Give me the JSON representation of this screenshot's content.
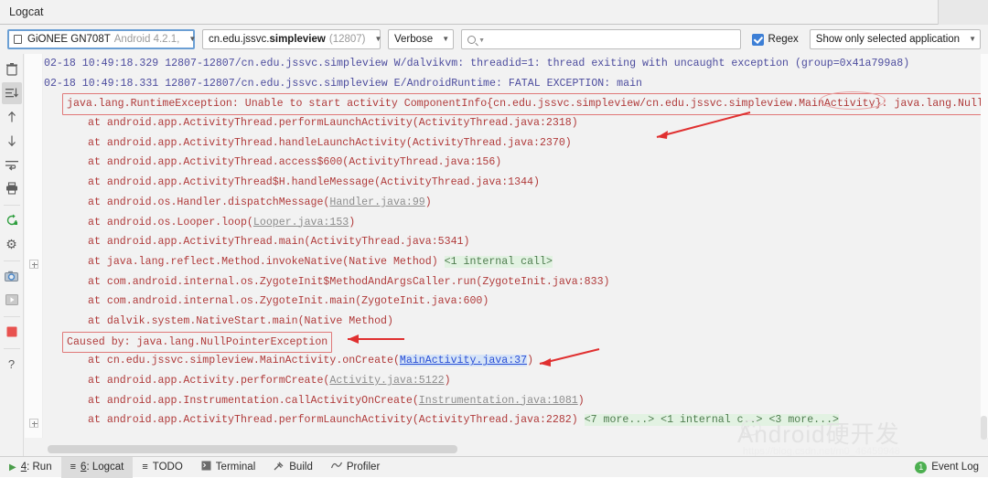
{
  "window": {
    "title": "Logcat",
    "gear_icon": "gear-icon",
    "minimize_icon": "minimize-icon"
  },
  "toolbar": {
    "device": {
      "name": "GiONEE GN708T",
      "detail": "Android 4.2.1, ",
      "caret": "▼"
    },
    "process": {
      "prefix": "cn.edu.jssvc.",
      "name": "simpleview",
      "pid": "(12807)",
      "caret": "▼"
    },
    "level": {
      "value": "Verbose",
      "caret": "▼"
    },
    "search": {
      "value": "",
      "placeholder": ""
    },
    "regex": {
      "label": "Regex",
      "checked": true
    },
    "filter": {
      "value": "Show only selected application",
      "caret": "▼"
    }
  },
  "rail": {
    "items": [
      {
        "name": "clear-logcat-icon",
        "glyph": "🗑",
        "selected": false
      },
      {
        "name": "scroll-to-end-icon",
        "glyph": "≡↓",
        "selected": true
      },
      {
        "name": "up-arrow-icon",
        "glyph": "↑",
        "selected": false
      },
      {
        "name": "down-arrow-icon",
        "glyph": "↓",
        "selected": false
      },
      {
        "name": "soft-wrap-icon",
        "glyph": "↵",
        "selected": false
      },
      {
        "name": "print-icon",
        "glyph": "⎙",
        "selected": false
      },
      {
        "name": "restart-icon",
        "glyph": "↻",
        "selected": false
      },
      {
        "name": "settings-gear-icon",
        "glyph": "⚙",
        "selected": false
      },
      {
        "name": "screenshot-camera-icon",
        "glyph": "📷",
        "selected": false
      },
      {
        "name": "screen-record-icon",
        "glyph": "▶",
        "selected": false
      },
      {
        "name": "stop-icon",
        "glyph": "■",
        "selected": false
      },
      {
        "name": "help-icon",
        "glyph": "?",
        "selected": false
      }
    ]
  },
  "log": {
    "lines": [
      {
        "id": "line-1",
        "level": "warn",
        "indent": 0,
        "text": "02-18 10:49:18.329 12807-12807/cn.edu.jssvc.simpleview W/dalvikvm: threadid=1: thread exiting with uncaught exception (group=0x41a799a8)"
      },
      {
        "id": "line-2",
        "level": "warn",
        "indent": 0,
        "text": "02-18 10:49:18.331 12807-12807/cn.edu.jssvc.simpleview E/AndroidRuntime: FATAL EXCEPTION: main"
      },
      {
        "id": "line-3",
        "level": "err",
        "indent": 1,
        "boxed": true,
        "text": "java.lang.RuntimeException: Unable to start activity ComponentInfo{cn.edu.jssvc.simpleview/cn.edu.jssvc.simpleview.MainActivity}: java.lang.NullP"
      },
      {
        "id": "line-4",
        "level": "err",
        "indent": 2,
        "text": "at android.app.ActivityThread.performLaunchActivity(ActivityThread.java:2318)"
      },
      {
        "id": "line-5",
        "level": "err",
        "indent": 2,
        "text": "at android.app.ActivityThread.handleLaunchActivity(ActivityThread.java:2370)"
      },
      {
        "id": "line-6",
        "level": "err",
        "indent": 2,
        "text": "at android.app.ActivityThread.access$600(ActivityThread.java:156)"
      },
      {
        "id": "line-7",
        "level": "err",
        "indent": 2,
        "text": "at android.app.ActivityThread$H.handleMessage(ActivityThread.java:1344)"
      },
      {
        "id": "line-8",
        "level": "err",
        "indent": 2,
        "text": "at android.os.Handler.dispatchMessage(",
        "link": "Handler.java:99",
        "suffix": ")"
      },
      {
        "id": "line-9",
        "level": "err",
        "indent": 2,
        "text": "at android.os.Looper.loop(",
        "link": "Looper.java:153",
        "suffix": ")"
      },
      {
        "id": "line-10",
        "level": "err",
        "indent": 2,
        "text": "at android.app.ActivityThread.main(ActivityThread.java:5341)"
      },
      {
        "id": "line-11",
        "level": "err",
        "indent": 2,
        "text": "at java.lang.reflect.Method.invokeNative(Native Method) ",
        "badge": "<1 internal call>"
      },
      {
        "id": "line-12",
        "level": "err",
        "indent": 2,
        "text": "at com.android.internal.os.ZygoteInit$MethodAndArgsCaller.run(ZygoteInit.java:833)"
      },
      {
        "id": "line-13",
        "level": "err",
        "indent": 2,
        "text": "at com.android.internal.os.ZygoteInit.main(ZygoteInit.java:600)"
      },
      {
        "id": "line-14",
        "level": "err",
        "indent": 2,
        "text": "at dalvik.system.NativeStart.main(Native Method)"
      },
      {
        "id": "line-15",
        "level": "err",
        "indent": 1,
        "boxed": true,
        "text": "Caused by: java.lang.NullPointerException"
      },
      {
        "id": "line-16",
        "level": "err",
        "indent": 2,
        "text": "at cn.edu.jssvc.simpleview.MainActivity.onCreate(",
        "link": "MainActivity.java:37",
        "link_style": "blue",
        "suffix": ")"
      },
      {
        "id": "line-17",
        "level": "err",
        "indent": 2,
        "text": "at android.app.Activity.performCreate(",
        "link": "Activity.java:5122",
        "suffix": ")"
      },
      {
        "id": "line-18",
        "level": "err",
        "indent": 2,
        "text": "at android.app.Instrumentation.callActivityOnCreate(",
        "link": "Instrumentation.java:1081",
        "suffix": ")"
      },
      {
        "id": "line-19",
        "level": "err",
        "indent": 2,
        "text": "at android.app.ActivityThread.performLaunchActivity(ActivityThread.java:2282) ",
        "badge": "<7 more...> <1 internal c..> <3 more...>"
      }
    ]
  },
  "statusbar": {
    "items": [
      {
        "name": "status-run",
        "icon": "run-play-icon",
        "num": "4",
        "label": ": Run",
        "active": false
      },
      {
        "name": "status-logcat",
        "icon": "logcat-lines-icon",
        "num": "6",
        "label": ": Logcat",
        "active": true
      },
      {
        "name": "status-todo",
        "icon": "todo-list-icon",
        "num": "",
        "label": "TODO",
        "active": false
      },
      {
        "name": "status-terminal",
        "icon": "terminal-icon",
        "num": "",
        "label": "Terminal",
        "active": false
      },
      {
        "name": "status-build",
        "icon": "hammer-icon",
        "num": "",
        "label": "Build",
        "active": false
      },
      {
        "name": "status-profiler",
        "icon": "profiler-icon",
        "num": "",
        "label": "Profiler",
        "active": false
      }
    ],
    "event_log": {
      "count": "1",
      "label": "Event Log"
    }
  },
  "watermark": {
    "text": "Android硬开发",
    "url": "https://blog.csdn.net/m0_46459948"
  }
}
